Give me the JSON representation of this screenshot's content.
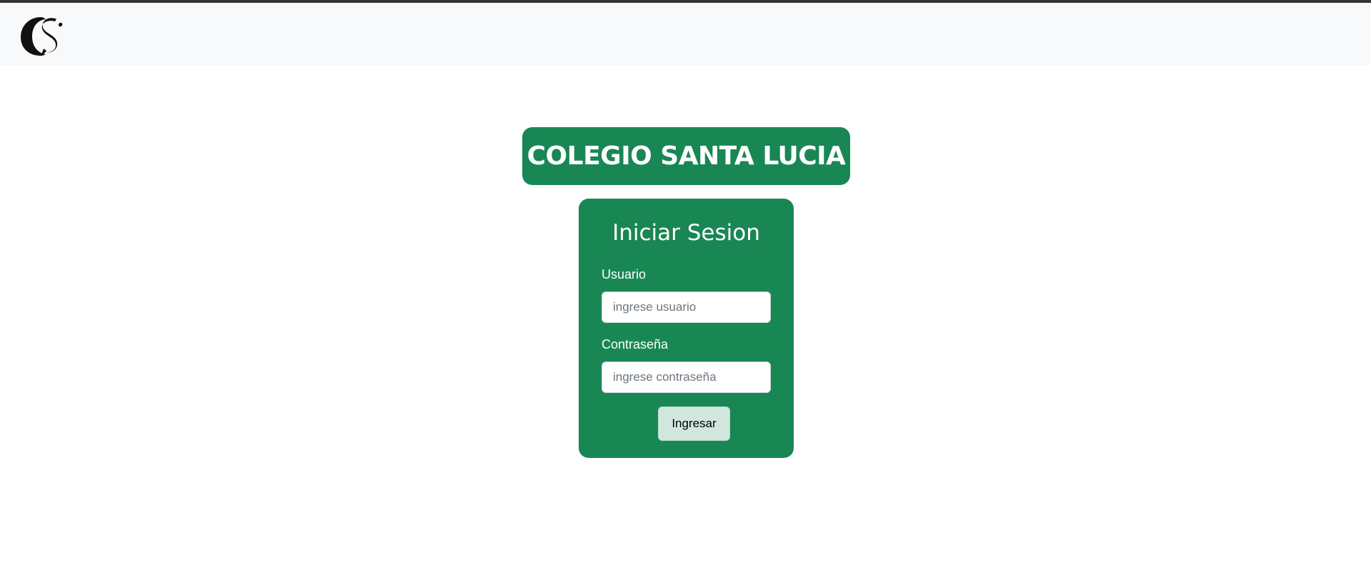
{
  "navbar": {
    "logo_icon": "cs-monogram-logo"
  },
  "header": {
    "title": "COLEGIO SANTA LUCIA"
  },
  "login": {
    "heading": "Iniciar Sesion",
    "username": {
      "label": "Usuario",
      "value": "",
      "placeholder": "ingrese usuario"
    },
    "password": {
      "label": "Contraseña",
      "value": "",
      "placeholder": "ingrese contraseña"
    },
    "submit_label": "Ingresar"
  },
  "colors": {
    "brand_green": "#198754",
    "button_bg": "#d1e7dd",
    "navbar_bg": "#f8f9fa",
    "top_border": "#343434"
  }
}
